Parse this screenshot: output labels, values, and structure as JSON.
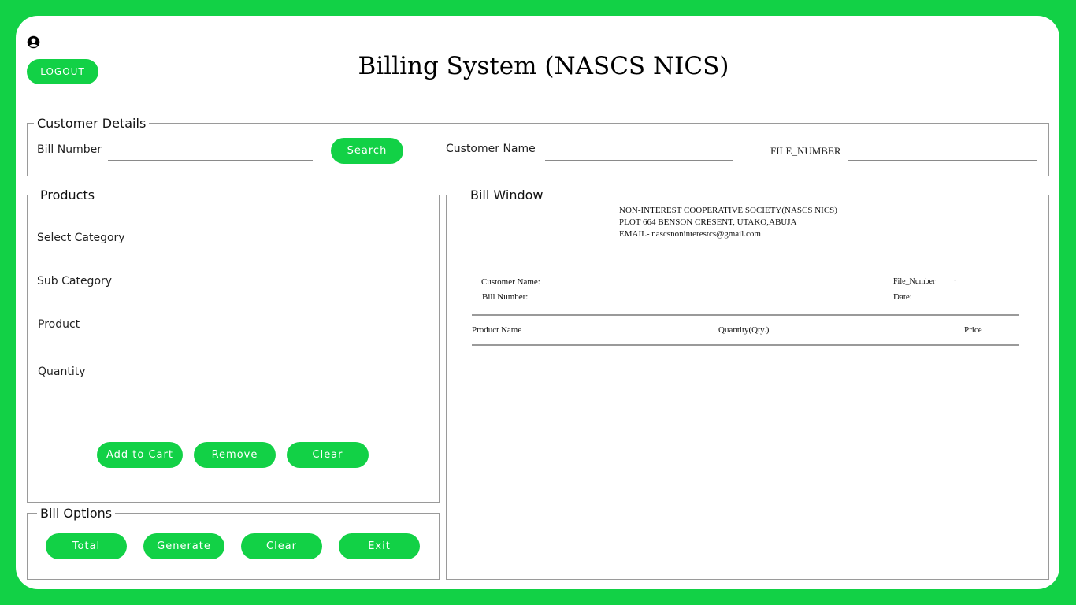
{
  "header": {
    "title": "Billing System (NASCS NICS)",
    "logout_label": "LOGOUT",
    "user_icon": "user-circle-icon"
  },
  "customer_details": {
    "legend": "Customer Details",
    "bill_number_label": "Bill Number",
    "bill_number_value": "",
    "search_label": "Search",
    "customer_name_label": "Customer Name",
    "customer_name_value": "",
    "file_number_label": "FILE_NUMBER",
    "file_number_value": ""
  },
  "products": {
    "legend": "Products",
    "select_category_label": "Select Category",
    "sub_category_label": "Sub Category",
    "product_label": "Product",
    "quantity_label": "Quantity",
    "add_to_cart_label": "Add to Cart",
    "remove_label": "Remove",
    "clear_label": "Clear"
  },
  "bill_options": {
    "legend": "Bill Options",
    "total_label": "Total",
    "generate_label": "Generate",
    "clear_label": "Clear",
    "exit_label": "Exit"
  },
  "bill_window": {
    "legend": "Bill Window",
    "org_name": "NON-INTEREST COOPERATIVE SOCIETY(NASCS NICS)",
    "org_address": "PLOT 664 BENSON CRESENT, UTAKO,ABUJA",
    "org_email": "EMAIL- nascsnoninterestcs@gmail.com",
    "customer_name_label": "Customer Name:",
    "bill_number_label": "Bill Number:",
    "file_number_label": "File_Number",
    "file_number_sep": ":",
    "date_label": "Date:",
    "col_product": "Product Name",
    "col_quantity": "Quantity(Qty.)",
    "col_price": "Price"
  },
  "colors": {
    "accent": "#12d146",
    "background": "#ffffff",
    "border": "#9a9a9a"
  }
}
